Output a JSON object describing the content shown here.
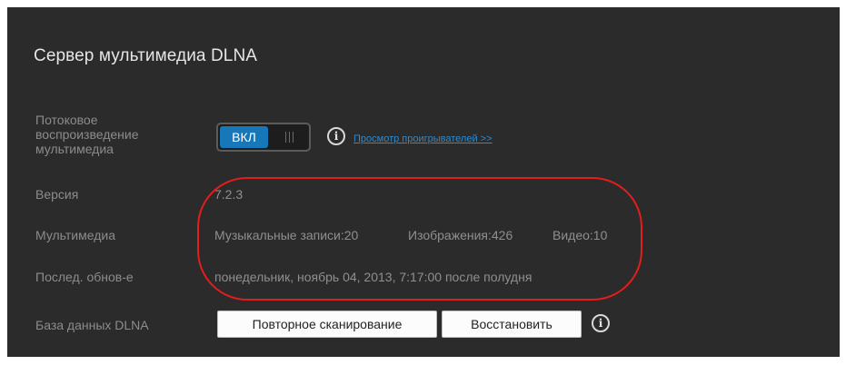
{
  "panel": {
    "title": "Сервер мультимедиа DLNA"
  },
  "streaming": {
    "label_lines": [
      "Потоковое",
      "воспроизведение",
      "мультимедиа"
    ],
    "toggle_on_label": "ВКЛ",
    "toggle_state": "on",
    "info_icon": "info-icon",
    "players_link": "Просмотр проигрывателей >>"
  },
  "version": {
    "label": "Версия",
    "value": "7.2.3"
  },
  "media": {
    "label": "Мультимедиа",
    "music": "Музыкальные записи:20",
    "images": "Изображения:426",
    "video": "Видео:10"
  },
  "last_update": {
    "label": "Послед. обнов-е",
    "value": "понедельник, ноябрь 04, 2013, 7:17:00 после полудня"
  },
  "database": {
    "label": "База данных DLNA",
    "rescan_button": "Повторное сканирование",
    "restore_button": "Восстановить",
    "info_icon": "info-icon"
  },
  "colors": {
    "panel_bg": "#2b2b2b",
    "accent": "#1678b8",
    "link": "#2d8bd0",
    "highlight": "#e41d1d"
  }
}
